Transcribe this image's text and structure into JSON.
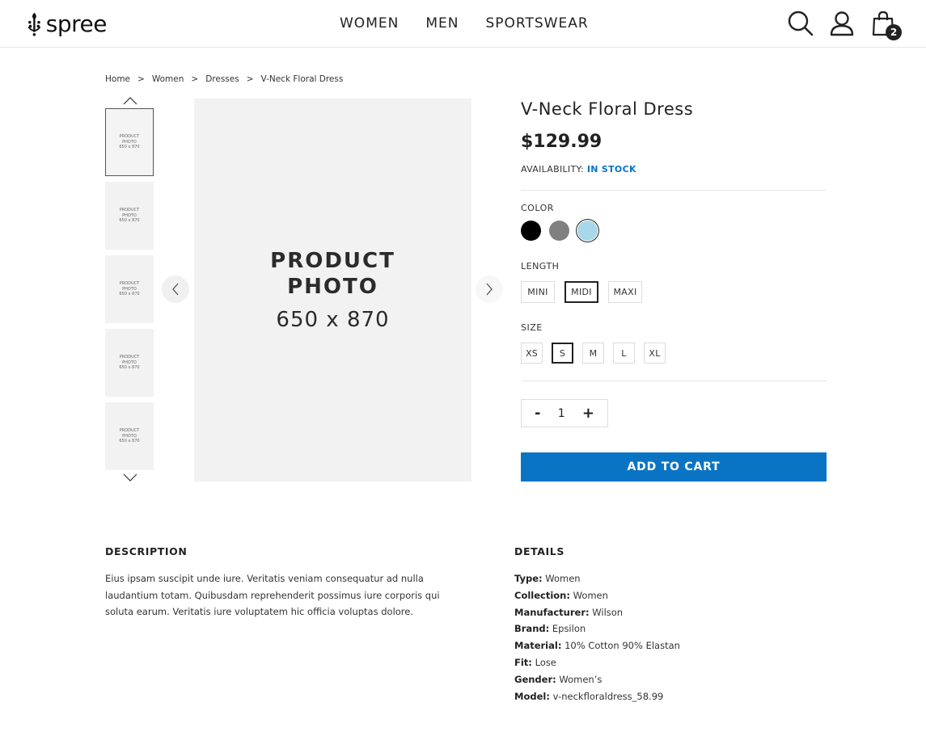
{
  "header": {
    "logo_text": "spree",
    "nav": [
      "WOMEN",
      "MEN",
      "SPORTSWEAR"
    ],
    "icons": [
      "search-icon",
      "user-icon",
      "cart-icon"
    ],
    "cart_count": "2"
  },
  "breadcrumb": [
    "Home",
    "Women",
    "Dresses",
    "V-Neck Floral Dress"
  ],
  "breadcrumb_separator": ">",
  "gallery": {
    "thumb_line1": "PRODUCT",
    "thumb_line2": "PHOTO",
    "thumb_line3": "650 x 870",
    "photo_line1": "PRODUCT",
    "photo_line2": "PHOTO",
    "photo_line3": "650 x 870",
    "thumb_count": 5
  },
  "product": {
    "title": "V-Neck Floral Dress",
    "price": "$129.99",
    "availability_label": "AVAILABILITY:",
    "availability_value": "IN STOCK",
    "color_label": "COLOR",
    "colors": [
      {
        "name": "black",
        "hex": "#000000"
      },
      {
        "name": "gray",
        "hex": "#808080"
      },
      {
        "name": "light-blue",
        "hex": "#a9d7ea"
      }
    ],
    "selected_color": "light-blue",
    "length_label": "LENGTH",
    "lengths": [
      "MINI",
      "MIDI",
      "MAXI"
    ],
    "selected_length": "MIDI",
    "size_label": "SIZE",
    "sizes": [
      "XS",
      "S",
      "M",
      "L",
      "XL"
    ],
    "selected_size": "S",
    "qty_minus": "-",
    "qty_value": "1",
    "qty_plus": "+",
    "add_to_cart": "ADD TO CART"
  },
  "description": {
    "title": "DESCRIPTION",
    "text": "Eius ipsam suscipit unde iure. Veritatis veniam consequatur ad nulla laudantium totam. Quibusdam reprehenderit possimus iure corporis qui soluta earum. Veritatis iure voluptatem hic officia voluptas dolore."
  },
  "details": {
    "title": "DETAILS",
    "rows": [
      {
        "k": "Type:",
        "v": "Women"
      },
      {
        "k": "Collection:",
        "v": "Women"
      },
      {
        "k": "Manufacturer:",
        "v": "Wilson"
      },
      {
        "k": "Brand:",
        "v": "Epsilon"
      },
      {
        "k": "Material:",
        "v": "10% Cotton 90% Elastan"
      },
      {
        "k": "Fit:",
        "v": "Lose"
      },
      {
        "k": "Gender:",
        "v": "Women’s"
      },
      {
        "k": "Model:",
        "v": "v-neckfloraldress_58.99"
      }
    ]
  },
  "colors": {
    "accent": "#0a74c4",
    "text": "#222222",
    "photo_bg": "#f2f2f2"
  }
}
